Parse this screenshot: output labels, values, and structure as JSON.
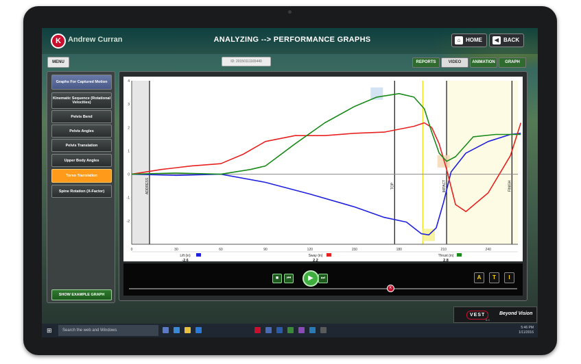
{
  "header": {
    "user_name": "Andrew Curran",
    "title": "ANALYZING --> PERFORMANCE GRAPHS",
    "home_label": "HOME",
    "back_label": "BACK"
  },
  "toolbar": {
    "menu_label": "MENU",
    "capture_id": "ID: 20150111165440",
    "tabs": [
      {
        "label": "REPORTS",
        "selected": false
      },
      {
        "label": "VIDEO",
        "selected": true
      },
      {
        "label": "ANIMATION",
        "selected": false
      },
      {
        "label": "GRAPH",
        "selected": false
      }
    ]
  },
  "sidebar": {
    "header_label": "Graphs For Captured Motion",
    "items": [
      {
        "label": "Kinematic Sequence (Rotational Velocities)",
        "active": false
      },
      {
        "label": "Pelvis Bend",
        "active": false
      },
      {
        "label": "Pelvis Angles",
        "active": false
      },
      {
        "label": "Pelvis Translation",
        "active": false
      },
      {
        "label": "Upper Body Angles",
        "active": false
      },
      {
        "label": "Torso Translation",
        "active": true
      },
      {
        "label": "Spine Rotation (X-Factor)",
        "active": false
      }
    ],
    "example_button": "SHOW EXAMPLE GRAPH"
  },
  "chart_data": {
    "type": "line",
    "xlim": [
      0,
      260
    ],
    "ylim": [
      -3,
      4
    ],
    "xticks": [
      0,
      30,
      60,
      90,
      120,
      150,
      180,
      210,
      240
    ],
    "yticks": [
      -2,
      -1,
      0,
      1,
      2,
      3,
      4
    ],
    "phase_labels": [
      "ADDRESS",
      "TOP",
      "IMPACT",
      "FINISH"
    ],
    "phase_x": [
      12,
      177,
      212,
      256
    ],
    "current_frame_x": 196,
    "series": [
      {
        "name": "Lift (in)",
        "color": "#1f1fe0",
        "current_value": "-2.6",
        "x": [
          0,
          30,
          60,
          90,
          120,
          150,
          170,
          185,
          195,
          200,
          205,
          210,
          215,
          225,
          240,
          255,
          262
        ],
        "y": [
          0,
          -0.05,
          0,
          -0.35,
          -0.85,
          -1.4,
          -1.85,
          -2.05,
          -2.55,
          -2.6,
          -2.3,
          -1.2,
          0.1,
          0.9,
          1.4,
          1.7,
          1.75
        ]
      },
      {
        "name": "Sway (in)",
        "color": "#e82020",
        "current_value": "2.2",
        "x": [
          0,
          20,
          40,
          60,
          75,
          90,
          110,
          130,
          150,
          170,
          190,
          197,
          202,
          207,
          212,
          218,
          225,
          240,
          255,
          262
        ],
        "y": [
          0,
          0.2,
          0.35,
          0.45,
          0.85,
          1.4,
          1.65,
          1.65,
          1.75,
          1.8,
          2.05,
          2.2,
          2.0,
          1.3,
          0.2,
          -1.3,
          -1.6,
          -0.8,
          0.8,
          2.2
        ]
      },
      {
        "name": "Thrust (in)",
        "color": "#1a8a1a",
        "current_value": "2.8",
        "x": [
          0,
          30,
          60,
          80,
          90,
          110,
          130,
          150,
          165,
          180,
          190,
          197,
          202,
          207,
          212,
          218,
          230,
          245,
          262
        ],
        "y": [
          0,
          0.05,
          0,
          0.2,
          0.35,
          1.3,
          2.2,
          2.9,
          3.3,
          3.45,
          3.3,
          2.8,
          1.8,
          0.9,
          0.55,
          0.75,
          1.6,
          1.7,
          1.7
        ]
      }
    ]
  },
  "playback": {
    "stop_icon": "stop-icon",
    "prev_icon": "skip-back-icon",
    "play_icon": "play-icon",
    "next_icon": "skip-forward-icon",
    "side_buttons": [
      "A",
      "T",
      "I"
    ],
    "position_fraction": 0.68
  },
  "brand": {
    "logo_text": "VEST",
    "tagline": "Beyond Vision",
    "version": "6.0"
  },
  "taskbar": {
    "search_placeholder": "Search the web and Windows",
    "time": "5:46 PM",
    "date": "1/11/2016"
  }
}
